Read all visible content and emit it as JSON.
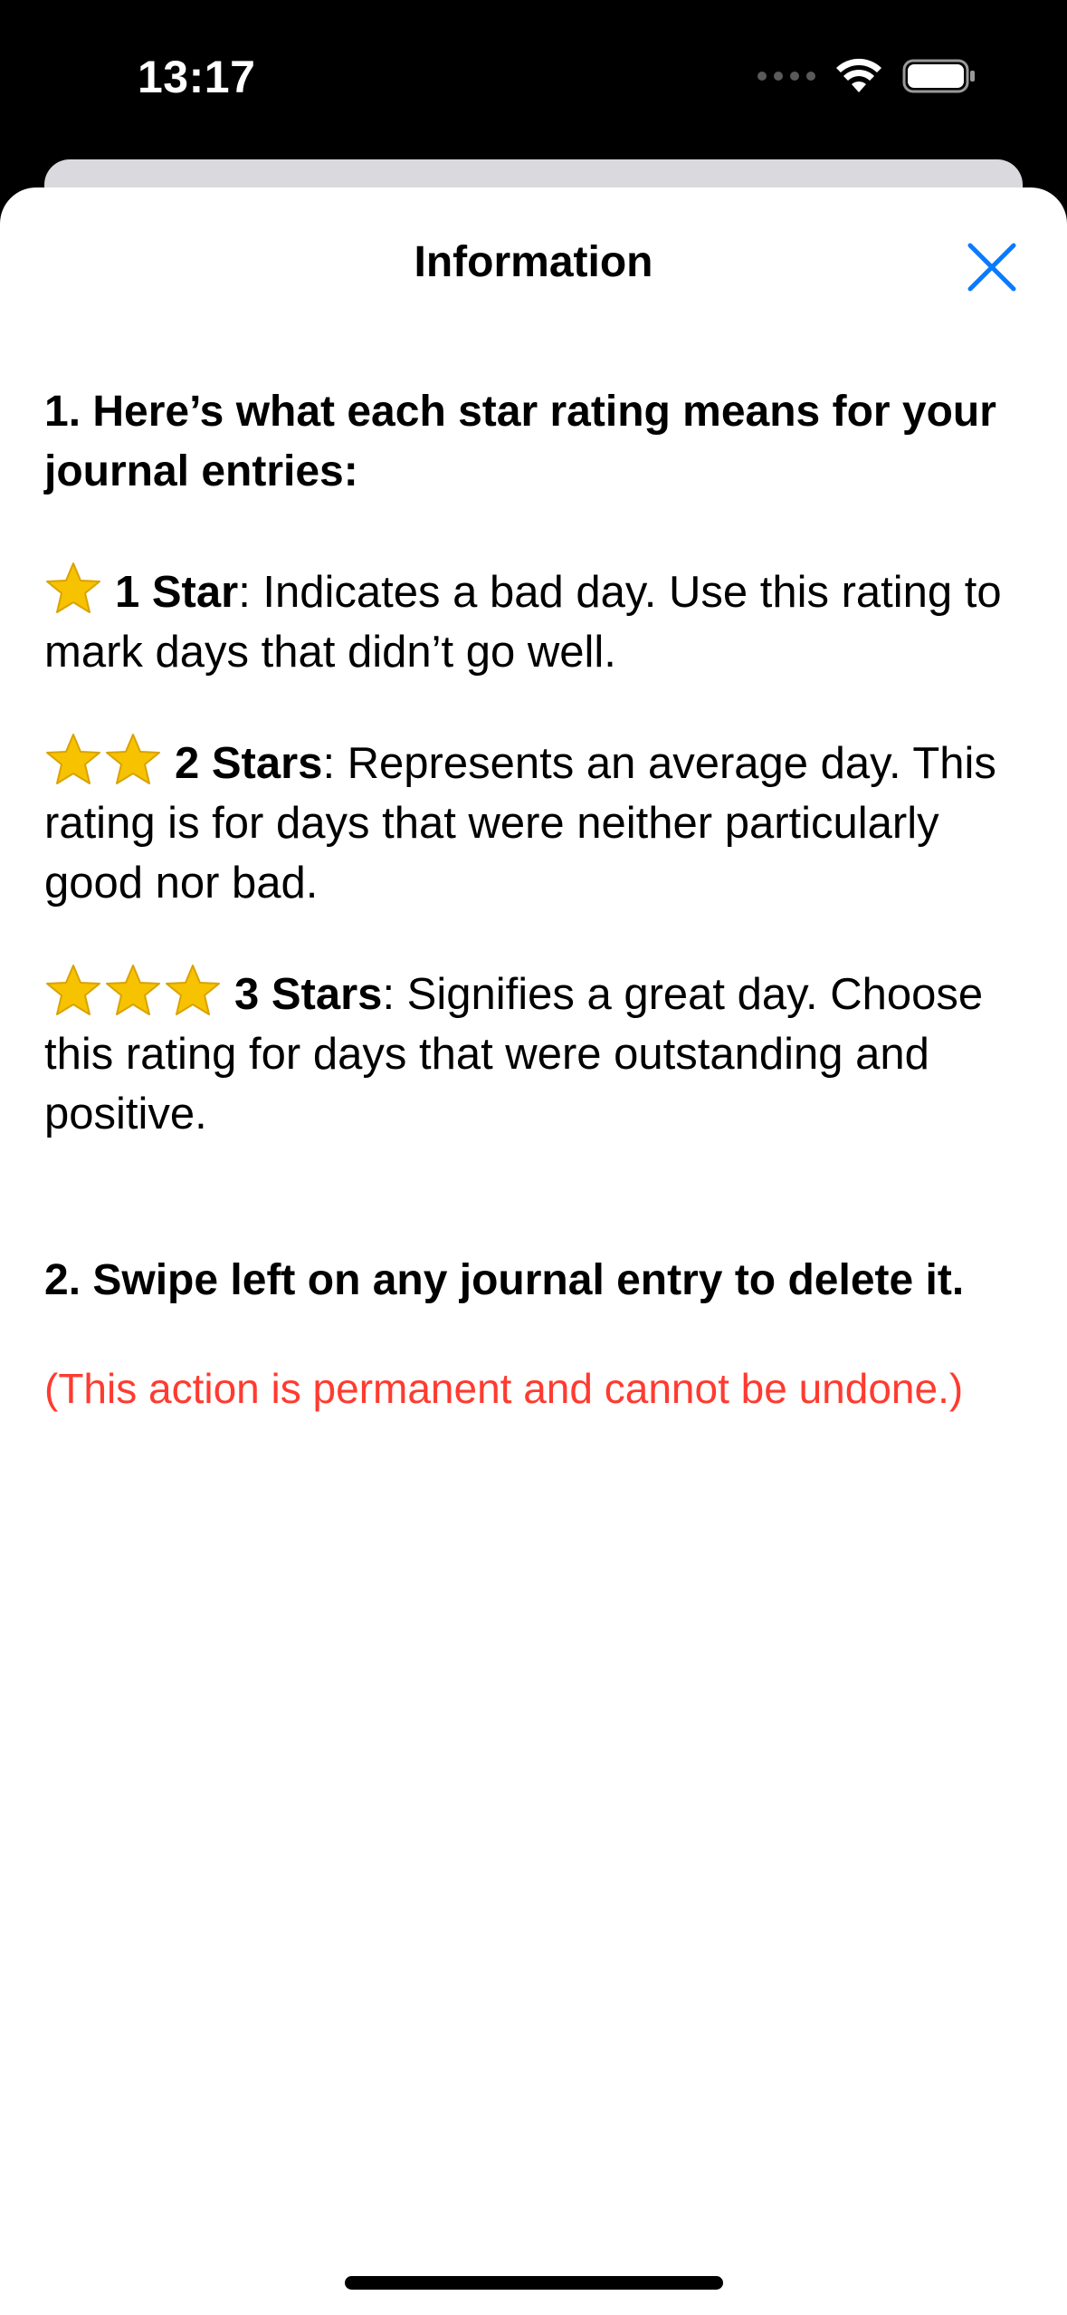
{
  "status_bar": {
    "time": "13:17"
  },
  "sheet": {
    "title": "Information",
    "close_icon": "close-icon"
  },
  "section1": {
    "heading": "1. Here’s what each star rating means for your journal entries:",
    "ratings": [
      {
        "stars": 1,
        "label": "1 Star",
        "description": ": Indicates a bad day. Use this rating to mark days that didn’t go well."
      },
      {
        "stars": 2,
        "label": "2 Stars",
        "description": ": Represents an average day. This rating is for days that were neither particularly good nor bad."
      },
      {
        "stars": 3,
        "label": "3 Stars",
        "description": ": Signifies a great day. Choose this rating for days that were outstanding and positive."
      }
    ]
  },
  "section2": {
    "heading": "2. Swipe left on any journal entry to delete it.",
    "warning": "(This action is permanent and cannot be undone.)"
  },
  "colors": {
    "accent": "#0a7aff",
    "warning": "#ff3b30",
    "star": "#f7c300"
  }
}
